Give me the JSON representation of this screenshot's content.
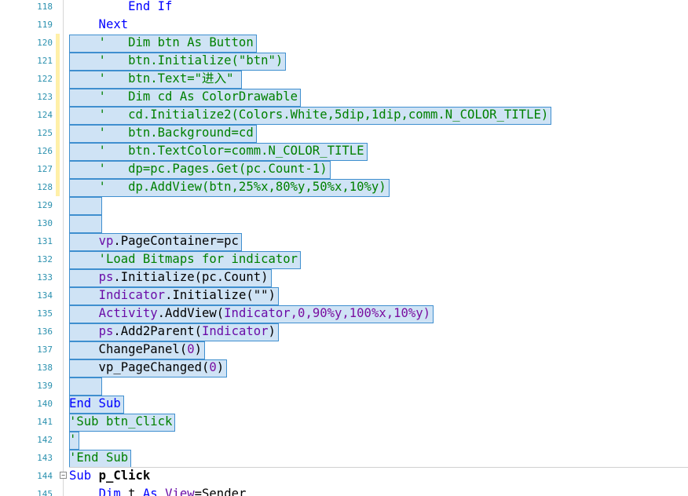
{
  "lines": [
    {
      "n": "118",
      "changed": false,
      "segs": [
        {
          "t": "        End If",
          "c": "k"
        }
      ]
    },
    {
      "n": "119",
      "changed": false,
      "segs": [
        {
          "t": "    Next",
          "c": "k"
        }
      ]
    },
    {
      "n": "120",
      "changed": true,
      "segs": [
        {
          "t": "    '   Dim btn As Button",
          "c": "c"
        }
      ]
    },
    {
      "n": "121",
      "changed": true,
      "segs": [
        {
          "t": "    '   btn.Initialize(\"btn\")",
          "c": "c"
        }
      ]
    },
    {
      "n": "122",
      "changed": true,
      "segs": [
        {
          "t": "    '   btn.Text=\"进入\"",
          "c": "c"
        }
      ]
    },
    {
      "n": "123",
      "changed": true,
      "segs": [
        {
          "t": "    '   Dim cd As ColorDrawable",
          "c": "c"
        }
      ]
    },
    {
      "n": "124",
      "changed": true,
      "segs": [
        {
          "t": "    '   cd.Initialize2(Colors.White,5dip,1dip,comm.N_COLOR_TITLE)",
          "c": "c"
        }
      ]
    },
    {
      "n": "125",
      "changed": true,
      "segs": [
        {
          "t": "    '   btn.Background=cd",
          "c": "c"
        }
      ]
    },
    {
      "n": "126",
      "changed": true,
      "segs": [
        {
          "t": "    '   btn.TextColor=comm.N_COLOR_TITLE",
          "c": "c"
        }
      ]
    },
    {
      "n": "127",
      "changed": true,
      "segs": [
        {
          "t": "    '   dp=pc.Pages.Get(pc.Count-1)",
          "c": "c"
        }
      ]
    },
    {
      "n": "128",
      "changed": true,
      "segs": [
        {
          "t": "    '   dp.AddView(btn,25%x,80%y,50%x,10%y)",
          "c": "c"
        }
      ]
    },
    {
      "n": "129",
      "changed": false,
      "segs": [
        {
          "t": "",
          "c": ""
        }
      ]
    },
    {
      "n": "130",
      "changed": false,
      "segs": [
        {
          "t": "",
          "c": ""
        }
      ]
    },
    {
      "n": "131",
      "changed": false,
      "segs": [
        {
          "t": "    ",
          "c": ""
        },
        {
          "t": "vp",
          "c": "v"
        },
        {
          "t": ".PageContainer=pc",
          "c": ""
        }
      ]
    },
    {
      "n": "132",
      "changed": false,
      "segs": [
        {
          "t": "    'Load Bitmaps for indicator",
          "c": "c"
        }
      ]
    },
    {
      "n": "133",
      "changed": false,
      "segs": [
        {
          "t": "    ",
          "c": ""
        },
        {
          "t": "ps",
          "c": "v"
        },
        {
          "t": ".Initialize(pc.Count)",
          "c": ""
        }
      ]
    },
    {
      "n": "134",
      "changed": false,
      "segs": [
        {
          "t": "    ",
          "c": ""
        },
        {
          "t": "Indicator",
          "c": "v"
        },
        {
          "t": ".Initialize(\"\")",
          "c": ""
        }
      ]
    },
    {
      "n": "135",
      "changed": false,
      "segs": [
        {
          "t": "    ",
          "c": ""
        },
        {
          "t": "Activity",
          "c": "v"
        },
        {
          "t": ".AddView(",
          "c": ""
        },
        {
          "t": "Indicator",
          "c": "v"
        },
        {
          "t": ",0,90%y,100%x,10%y)",
          "c": "v2"
        }
      ]
    },
    {
      "n": "136",
      "changed": false,
      "segs": [
        {
          "t": "    ",
          "c": ""
        },
        {
          "t": "ps",
          "c": "v"
        },
        {
          "t": ".Add2Parent(",
          "c": ""
        },
        {
          "t": "Indicator",
          "c": "v"
        },
        {
          "t": ")",
          "c": ""
        }
      ]
    },
    {
      "n": "137",
      "changed": false,
      "segs": [
        {
          "t": "    ChangePanel(",
          "c": ""
        },
        {
          "t": "0",
          "c": "v2"
        },
        {
          "t": ")",
          "c": ""
        }
      ]
    },
    {
      "n": "138",
      "changed": false,
      "segs": [
        {
          "t": "    vp_PageChanged(",
          "c": ""
        },
        {
          "t": "0",
          "c": "v2"
        },
        {
          "t": ")",
          "c": ""
        }
      ]
    },
    {
      "n": "139",
      "changed": false,
      "segs": [
        {
          "t": "",
          "c": ""
        }
      ]
    },
    {
      "n": "140",
      "changed": false,
      "segs": [
        {
          "t": "End Sub",
          "c": "k"
        }
      ]
    },
    {
      "n": "141",
      "changed": false,
      "segs": [
        {
          "t": "'Sub btn_Click",
          "c": "c"
        }
      ]
    },
    {
      "n": "142",
      "changed": false,
      "segs": [
        {
          "t": "'",
          "c": "c"
        }
      ]
    },
    {
      "n": "143",
      "changed": false,
      "segs": [
        {
          "t": "'End Sub",
          "c": "c"
        }
      ]
    },
    {
      "n": "144",
      "changed": false,
      "fold": true,
      "segs": [
        {
          "t": "Sub ",
          "c": "k"
        },
        {
          "t": "p_Click",
          "c": "bold"
        }
      ]
    },
    {
      "n": "145",
      "changed": false,
      "segs": [
        {
          "t": "    ",
          "c": ""
        },
        {
          "t": "Dim",
          "c": "k"
        },
        {
          "t": " t ",
          "c": ""
        },
        {
          "t": "As",
          "c": "k"
        },
        {
          "t": " ",
          "c": ""
        },
        {
          "t": "View",
          "c": "v"
        },
        {
          "t": "=Sender",
          "c": ""
        }
      ]
    }
  ],
  "icons": {
    "fold": "fold-collapse-icon"
  },
  "colors": {
    "keyword": "#0000ff",
    "comment": "#008000",
    "identifier": "#6a0da8",
    "line_number": "#2b91af",
    "selection": "#cfe3f5",
    "selection_border": "#3f8fcf",
    "changed_marker": "#fff0a8"
  }
}
